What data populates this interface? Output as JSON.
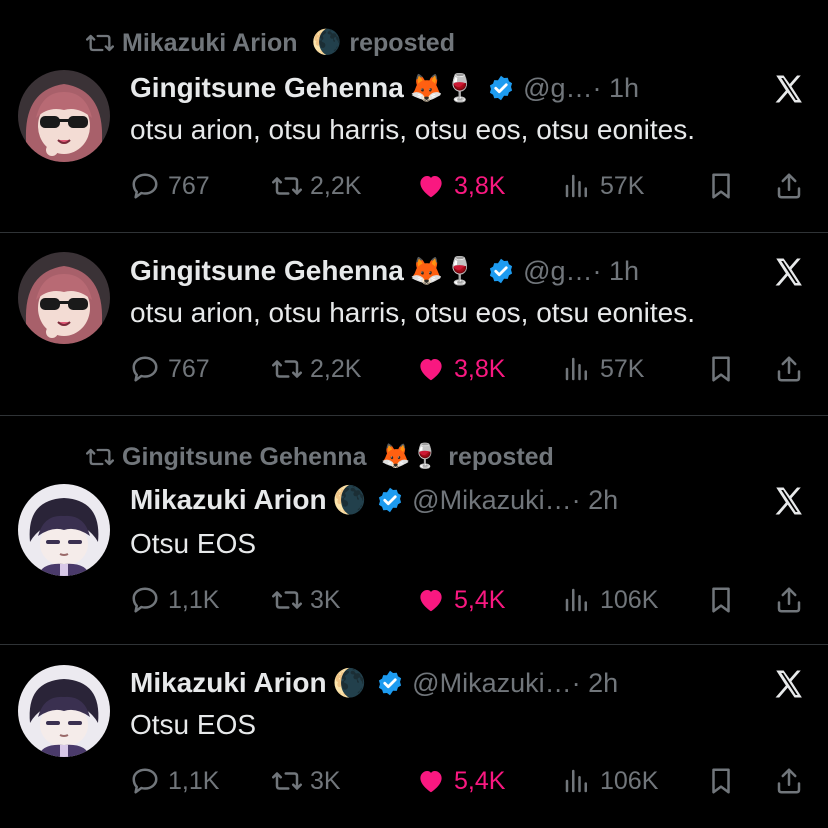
{
  "colors": {
    "background": "#000000",
    "text": "#e7e9ea",
    "muted": "#71767b",
    "like": "#f91880",
    "verified": "#1d9bf0",
    "divider": "#2f3336"
  },
  "posts": [
    {
      "repost": {
        "by": "Mikazuki Arion",
        "emoji": "🌘",
        "suffix": "reposted"
      },
      "author": {
        "name": "Gingitsune Gehenna",
        "emoji": "🦊🍷",
        "verified": true,
        "handle": "@g…",
        "time": "· 1h"
      },
      "text": "otsu arion, otsu harris, otsu eos, otsu eonites.",
      "stats": {
        "replies": "767",
        "reposts": "2,2K",
        "likes": "3,8K",
        "views": "57K"
      },
      "avatar_icon": "fox-girl-sunglasses-avatar"
    },
    {
      "repost": null,
      "author": {
        "name": "Gingitsune Gehenna",
        "emoji": "🦊🍷",
        "verified": true,
        "handle": "@g…",
        "time": "· 1h"
      },
      "text": "otsu arion, otsu harris, otsu eos, otsu eonites.",
      "stats": {
        "replies": "767",
        "reposts": "2,2K",
        "likes": "3,8K",
        "views": "57K"
      },
      "avatar_icon": "fox-girl-sunglasses-avatar"
    },
    {
      "repost": {
        "by": "Gingitsune Gehenna",
        "emoji": "🦊🍷",
        "suffix": "reposted"
      },
      "author": {
        "name": "Mikazuki Arion",
        "emoji": "🌘",
        "verified": true,
        "handle": "@Mikazuki…",
        "time": "· 2h"
      },
      "text": "Otsu EOS",
      "stats": {
        "replies": "1,1K",
        "reposts": "3K",
        "likes": "5,4K",
        "views": "106K"
      },
      "avatar_icon": "dark-haired-boy-avatar"
    },
    {
      "repost": null,
      "author": {
        "name": "Mikazuki Arion",
        "emoji": "🌘",
        "verified": true,
        "handle": "@Mikazuki…",
        "time": "· 2h"
      },
      "text": "Otsu EOS",
      "stats": {
        "replies": "1,1K",
        "reposts": "3K",
        "likes": "5,4K",
        "views": "106K"
      },
      "avatar_icon": "dark-haired-boy-avatar"
    }
  ]
}
